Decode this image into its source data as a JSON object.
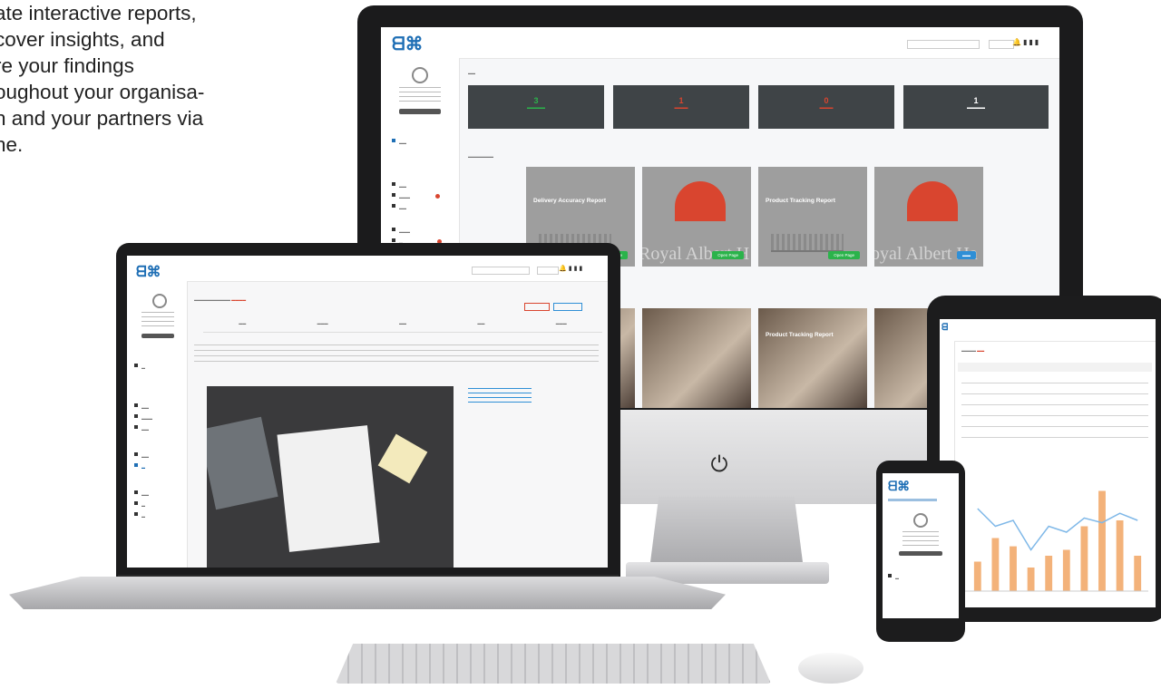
{
  "marketing": {
    "lines": [
      "ate interactive reports,",
      "cover insights, and",
      "re your findings",
      "oughout your organisa-",
      "n and your partners via",
      "ne."
    ]
  },
  "colors": {
    "brand_blue": "#1f6fb5",
    "stat_tile": "#3f4447",
    "success_green": "#2bb34b",
    "danger_red": "#d9452f",
    "chart_bar": "#f3b27a",
    "chart_line": "#7fb8e8"
  },
  "icons": {
    "power": "power-icon",
    "avatar": "user-icon"
  },
  "imac": {
    "stats": [
      {
        "value": "3",
        "color": "#2bb34b"
      },
      {
        "value": "1",
        "color": "#d9452f"
      },
      {
        "value": "0",
        "color": "#d9452f"
      },
      {
        "value": "1",
        "color": "#ffffff"
      }
    ],
    "cards": [
      {
        "title": "Delivery Accuracy Report",
        "button": "Open Page",
        "kind": "skyline"
      },
      {
        "title": "",
        "button": "Open Page",
        "kind": "dome",
        "watermark": "Royal Albert H"
      },
      {
        "title": "Product Tracking Report",
        "button": "Open Page",
        "kind": "skyline"
      },
      {
        "title": "",
        "button": "",
        "kind": "dome",
        "watermark": "oyal Albert Ha"
      }
    ],
    "photo_cards": [
      {
        "title": ""
      },
      {
        "title": ""
      },
      {
        "title": "Product Tracking Report"
      },
      {
        "title": ""
      }
    ]
  },
  "tablet": {
    "chart_data": {
      "type": "bar",
      "bars": [
        0.25,
        0.45,
        0.38,
        0.2,
        0.3,
        0.35,
        0.55,
        0.85,
        0.6,
        0.3
      ],
      "line": [
        0.7,
        0.55,
        0.6,
        0.35,
        0.55,
        0.5,
        0.62,
        0.58,
        0.66,
        0.6
      ]
    }
  }
}
